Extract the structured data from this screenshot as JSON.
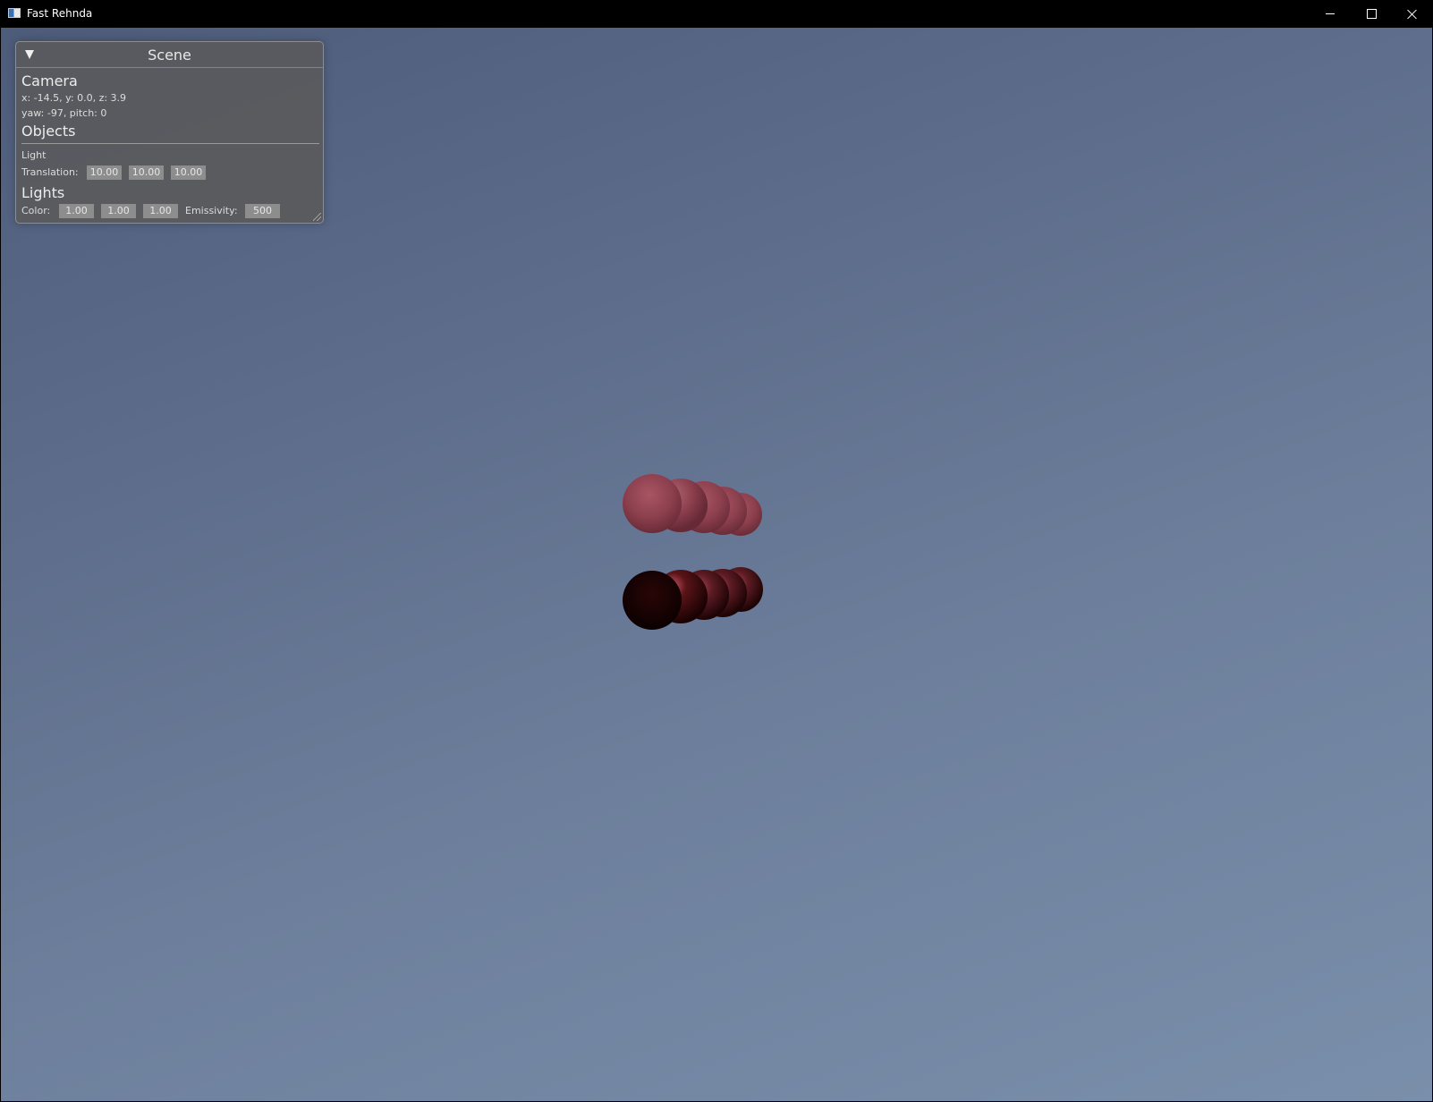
{
  "window": {
    "title": "Fast Rehnda",
    "controls": [
      "minimize",
      "maximize",
      "close"
    ]
  },
  "panel": {
    "title": "Scene",
    "camera": {
      "heading": "Camera",
      "position": "x: -14.5, y: 0.0, z: 3.9",
      "orientation": "yaw: -97, pitch: 0"
    },
    "objects": {
      "heading": "Objects",
      "selected_name": "Light",
      "translation_label": "Translation:",
      "translation": [
        "10.00",
        "10.00",
        "10.00"
      ]
    },
    "lights": {
      "heading": "Lights",
      "color_label": "Color:",
      "color": [
        "1.00",
        "1.00",
        "1.00"
      ],
      "emissivity_label": "Emissivity:",
      "emissivity": "500"
    }
  },
  "scene": {
    "background_colors": [
      "#4d5c7a",
      "#7a8fab"
    ],
    "sphere_color": "#9a4a57",
    "top_row_spheres": 5,
    "bottom_row_spheres": 5
  }
}
